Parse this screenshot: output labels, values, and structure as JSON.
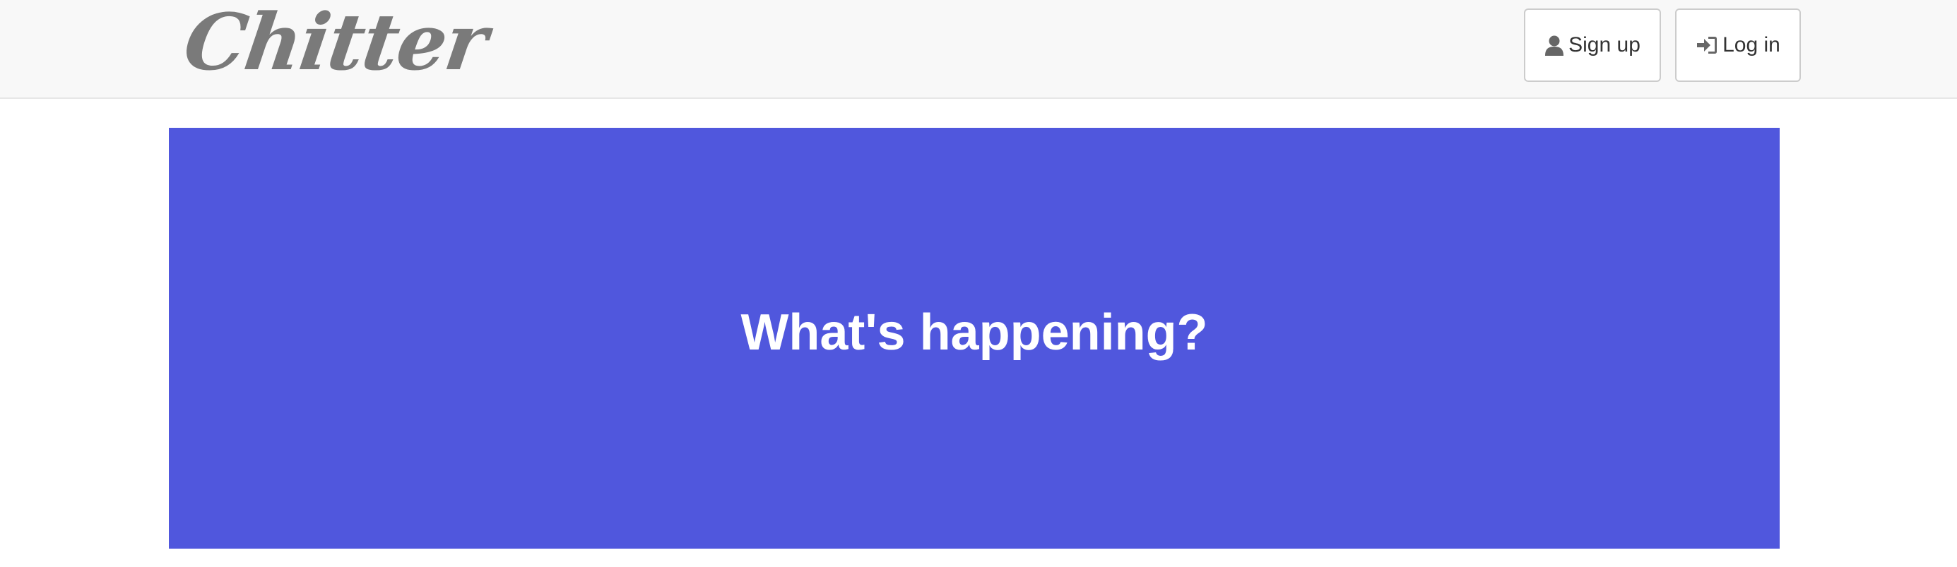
{
  "navbar": {
    "brand": "Chitter",
    "signup": {
      "label": "Sign up",
      "icon": "user-icon"
    },
    "login": {
      "label": "Log in",
      "icon": "log-in-icon"
    }
  },
  "hero": {
    "heading": "What's happening?",
    "background_color": "#5057dd"
  }
}
